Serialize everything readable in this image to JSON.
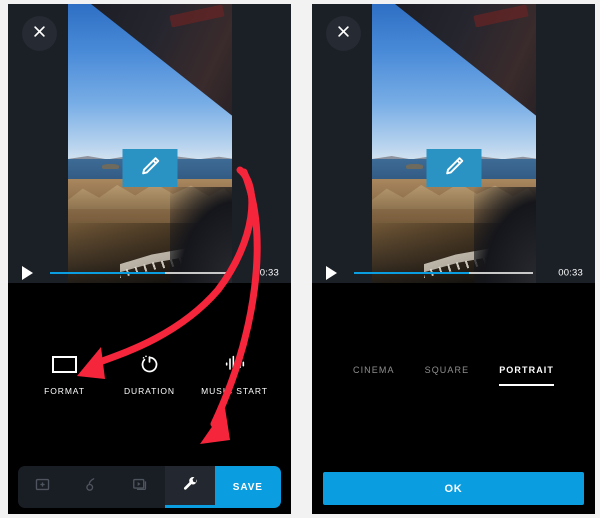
{
  "app": {
    "accent_blue": "#0a9de0",
    "annotation_red": "#f5263c",
    "edit_badge_color": "#2a93c4",
    "panel_bg": "#000000",
    "video_chrome_bg": "#1b1f26"
  },
  "left_panel": {
    "close_label": "close-icon",
    "edit_overlay": {
      "icon": "pencil-icon"
    },
    "player": {
      "play_icon": "play-icon",
      "time": "00:33",
      "progress_percent": 64
    },
    "tools": [
      {
        "label": "FORMAT",
        "icon": "rectangle-frame-icon"
      },
      {
        "label": "DURATION",
        "icon": "stopwatch-power-icon"
      },
      {
        "label": "MUSIC START",
        "icon": "audio-waveform-icon"
      }
    ],
    "tabbar": {
      "tabs": [
        {
          "icon": "add-photo-icon",
          "active": false
        },
        {
          "icon": "music-note-icon",
          "active": false
        },
        {
          "icon": "slideshow-icon",
          "active": false
        },
        {
          "icon": "wrench-icon",
          "active": true
        }
      ],
      "save_label": "SAVE"
    }
  },
  "right_panel": {
    "close_label": "close-icon",
    "edit_overlay": {
      "icon": "pencil-icon"
    },
    "player": {
      "play_icon": "play-icon",
      "time": "00:33",
      "progress_percent": 64
    },
    "format_options": [
      {
        "label": "CINEMA",
        "selected": false
      },
      {
        "label": "SQUARE",
        "selected": false
      },
      {
        "label": "PORTRAIT",
        "selected": true
      }
    ],
    "ok_label": "OK"
  },
  "annotations": [
    {
      "name": "arrow-to-format",
      "target": "FORMAT"
    },
    {
      "name": "arrow-to-wrench-tab",
      "target": "wrench-icon"
    }
  ]
}
